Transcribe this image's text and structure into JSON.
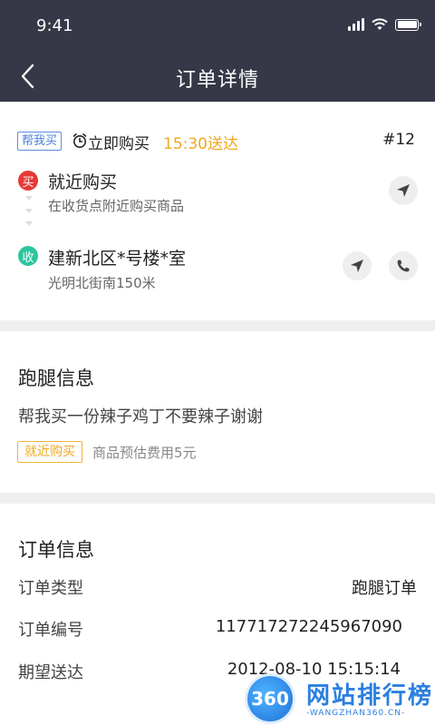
{
  "status_bar": {
    "time": "9:41"
  },
  "header": {
    "title": "订单详情"
  },
  "order": {
    "type_tag": "帮我买",
    "buy_mode": "立即购买",
    "deliver_time": "15:30送达",
    "number": "#12",
    "from": {
      "badge": "买",
      "title": "就近购买",
      "subtitle": "在收货点附近购买商品"
    },
    "to": {
      "badge": "收",
      "title": "建新北区*号楼*室",
      "subtitle": "光明北街南150米"
    }
  },
  "errand": {
    "title": "跑腿信息",
    "description": "帮我买一份辣子鸡丁不要辣子谢谢",
    "tag": "就近购买",
    "fee_note": "商品预估费用5元"
  },
  "order_info": {
    "title": "订单信息",
    "rows": [
      {
        "label": "订单类型",
        "value": "跑腿订单"
      },
      {
        "label": "订单编号",
        "value": "117717272245967090"
      },
      {
        "label": "期望送达",
        "value": "2012-08-10 15:15:14"
      }
    ]
  },
  "watermark": {
    "logo": "360",
    "text": "网站排行榜",
    "url": "-WANGZHAN360.CN-"
  },
  "colors": {
    "header_bg": "#363847",
    "accent_orange": "#f0a81e",
    "tag_blue": "#4a7fd8",
    "badge_red": "#e53935",
    "badge_green": "#2ec4a0"
  }
}
